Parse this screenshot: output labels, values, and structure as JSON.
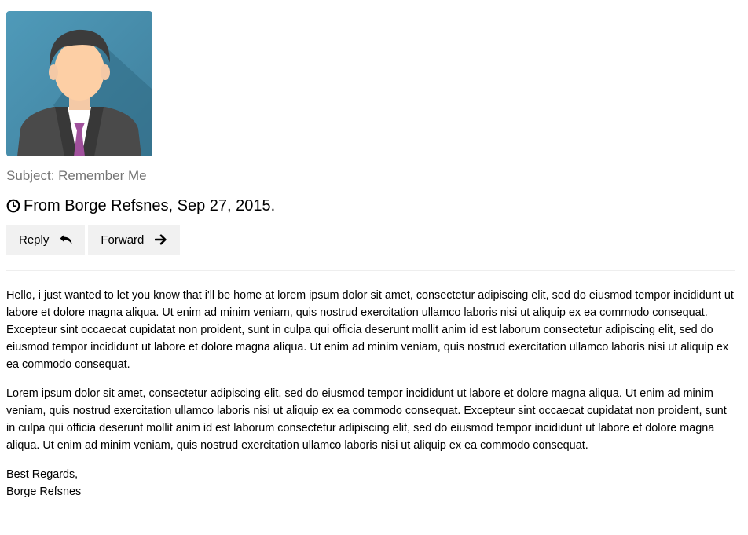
{
  "email": {
    "avatar_icon": "person-avatar-icon",
    "subject": "Subject: Remember Me",
    "from_icon": "clock-icon",
    "from": "From Borge Refsnes, Sep 27, 2015.",
    "actions": {
      "reply_label": "Reply",
      "reply_icon": "reply-icon",
      "forward_label": "Forward",
      "forward_icon": "arrow-right-icon"
    },
    "paragraphs": [
      "Hello, i just wanted to let you know that i'll be home at lorem ipsum dolor sit amet, consectetur adipiscing elit, sed do eiusmod tempor incididunt ut labore et dolore magna aliqua. Ut enim ad minim veniam, quis nostrud exercitation ullamco laboris nisi ut aliquip ex ea commodo consequat. Excepteur sint occaecat cupidatat non proident, sunt in culpa qui officia deserunt mollit anim id est laborum consectetur adipiscing elit, sed do eiusmod tempor incididunt ut labore et dolore magna aliqua. Ut enim ad minim veniam, quis nostrud exercitation ullamco laboris nisi ut aliquip ex ea commodo consequat.",
      "Lorem ipsum dolor sit amet, consectetur adipiscing elit, sed do eiusmod tempor incididunt ut labore et dolore magna aliqua. Ut enim ad minim veniam, quis nostrud exercitation ullamco laboris nisi ut aliquip ex ea commodo consequat. Excepteur sint occaecat cupidatat non proident, sunt in culpa qui officia deserunt mollit anim id est laborum consectetur adipiscing elit, sed do eiusmod tempor incididunt ut labore et dolore magna aliqua. Ut enim ad minim veniam, quis nostrud exercitation ullamco laboris nisi ut aliquip ex ea commodo consequat."
    ],
    "signature": {
      "closing": "Best Regards,",
      "name": "Borge Refsnes"
    }
  },
  "colors": {
    "avatar_bg": "#4a8fae",
    "button_bg": "#f1f1f1",
    "subject_text": "#757575",
    "tie": "#a0509c"
  }
}
